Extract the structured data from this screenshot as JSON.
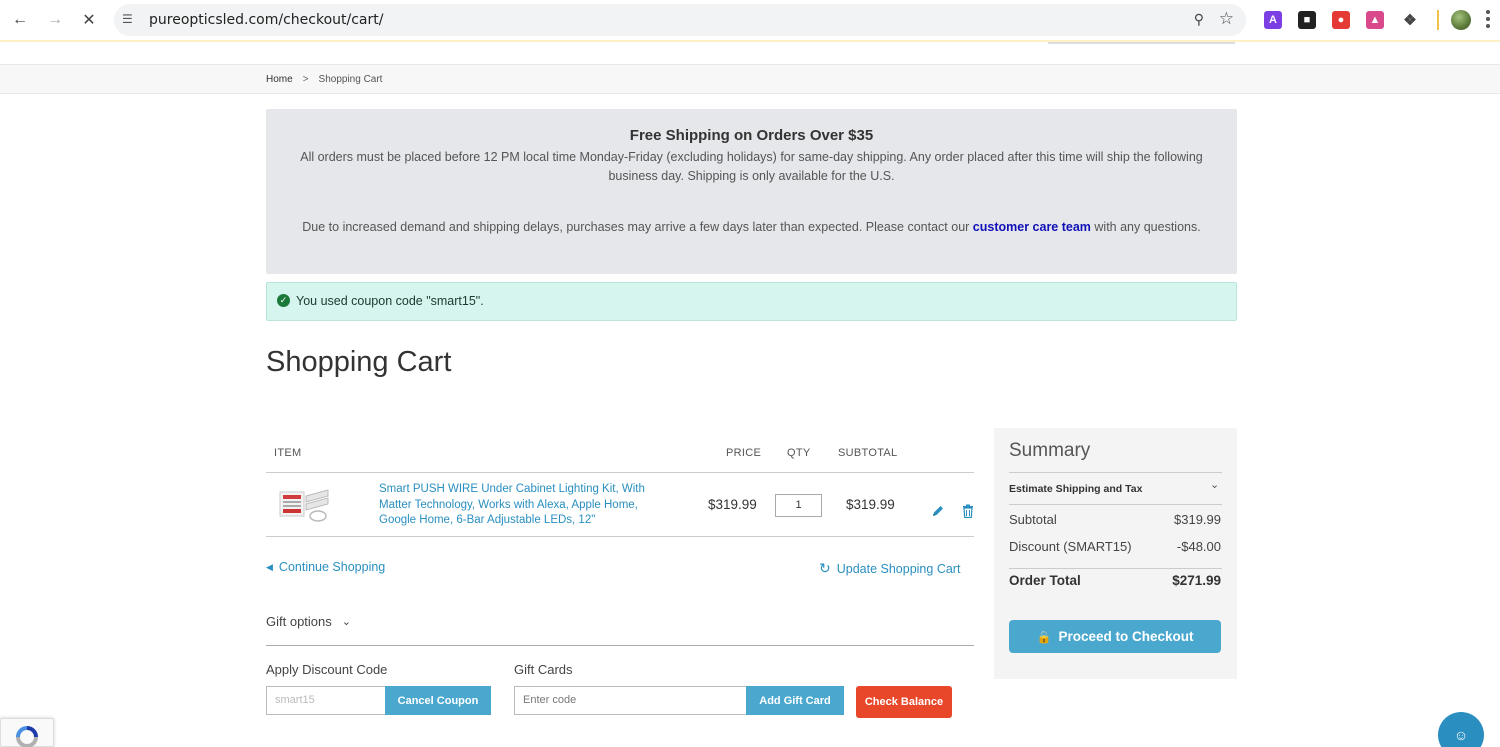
{
  "browser": {
    "url": "pureopticsled.com/checkout/cart/"
  },
  "breadcrumb": {
    "home": "Home",
    "separator": ">",
    "current": "Shopping Cart"
  },
  "notice": {
    "title": "Free Shipping on Orders Over $35",
    "paragraph1": "All orders must be placed before 12 PM local time Monday-Friday (excluding holidays) for same-day shipping. Any order placed after this time will ship the following business day. Shipping is only available for the U.S.",
    "paragraph2_before": "Due to increased demand and shipping delays, purchases may arrive a few days later than expected. Please contact our ",
    "paragraph2_link": "customer care team",
    "paragraph2_after": " with any questions."
  },
  "coupon_message": "You used coupon code \"smart15\".",
  "page_title": "Shopping Cart",
  "cart": {
    "headers": {
      "item": "ITEM",
      "price": "PRICE",
      "qty": "QTY",
      "subtotal": "SUBTOTAL"
    },
    "items": [
      {
        "name": "Smart PUSH WIRE Under Cabinet Lighting Kit, With Matter Technology, Works with Alexa, Apple Home, Google Home, 6-Bar Adjustable LEDs, 12\"",
        "price": "$319.99",
        "qty": "1",
        "subtotal": "$319.99"
      }
    ],
    "continue_label": "Continue Shopping",
    "update_label": "Update Shopping Cart"
  },
  "gift_options_label": "Gift options",
  "discount": {
    "label": "Apply Discount Code",
    "value": "smart15",
    "button": "Cancel Coupon"
  },
  "gift_cards": {
    "label": "Gift Cards",
    "placeholder": "Enter code",
    "add_button": "Add Gift Card",
    "balance_button": "Check Balance"
  },
  "summary": {
    "title": "Summary",
    "estimate_label": "Estimate Shipping and Tax",
    "subtotal_label": "Subtotal",
    "subtotal_value": "$319.99",
    "discount_label": "Discount (SMART15)",
    "discount_value": "-$48.00",
    "order_total_label": "Order Total",
    "order_total_value": "$271.99",
    "checkout_button": "Proceed to Checkout"
  },
  "colors": {
    "accent_blue": "#4aa8cf",
    "link_blue": "#2a8fc0",
    "alert_red": "#e8472a",
    "success_bg": "#d6f5ef"
  }
}
